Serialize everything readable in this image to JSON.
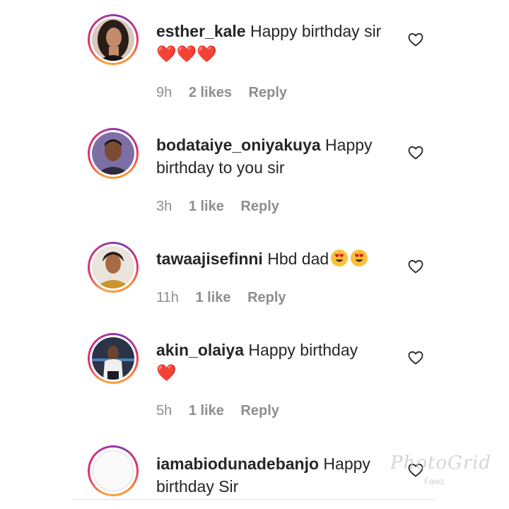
{
  "comments": [
    {
      "username": "esther_kale",
      "text": " Happy birthday sir",
      "emoji": "❤️❤️❤️",
      "time": "9h",
      "likes": "2 likes",
      "reply": "Reply"
    },
    {
      "username": "bodataiye_oniyakuya",
      "text": " Happy birthday to you sir",
      "emoji": "",
      "time": "3h",
      "likes": "1 like",
      "reply": "Reply"
    },
    {
      "username": "tawaajisefinni",
      "text": " Hbd dad",
      "emoji": "😍😍",
      "time": "11h",
      "likes": "1 like",
      "reply": "Reply"
    },
    {
      "username": "akin_olaiya",
      "text": " Happy birthday",
      "emoji": "❤️",
      "time": "5h",
      "likes": "1 like",
      "reply": "Reply"
    },
    {
      "username": "iamabiodunadebanjo",
      "text": " Happy birthday Sir",
      "emoji": ""
    }
  ],
  "watermark": {
    "brand": "PhotoGrid",
    "sub": "Fawz"
  },
  "colors": {
    "text": "#262626",
    "meta": "#8e8e8e",
    "heart": "#e0192b"
  },
  "icons": {
    "like": "heart-outline-icon"
  }
}
